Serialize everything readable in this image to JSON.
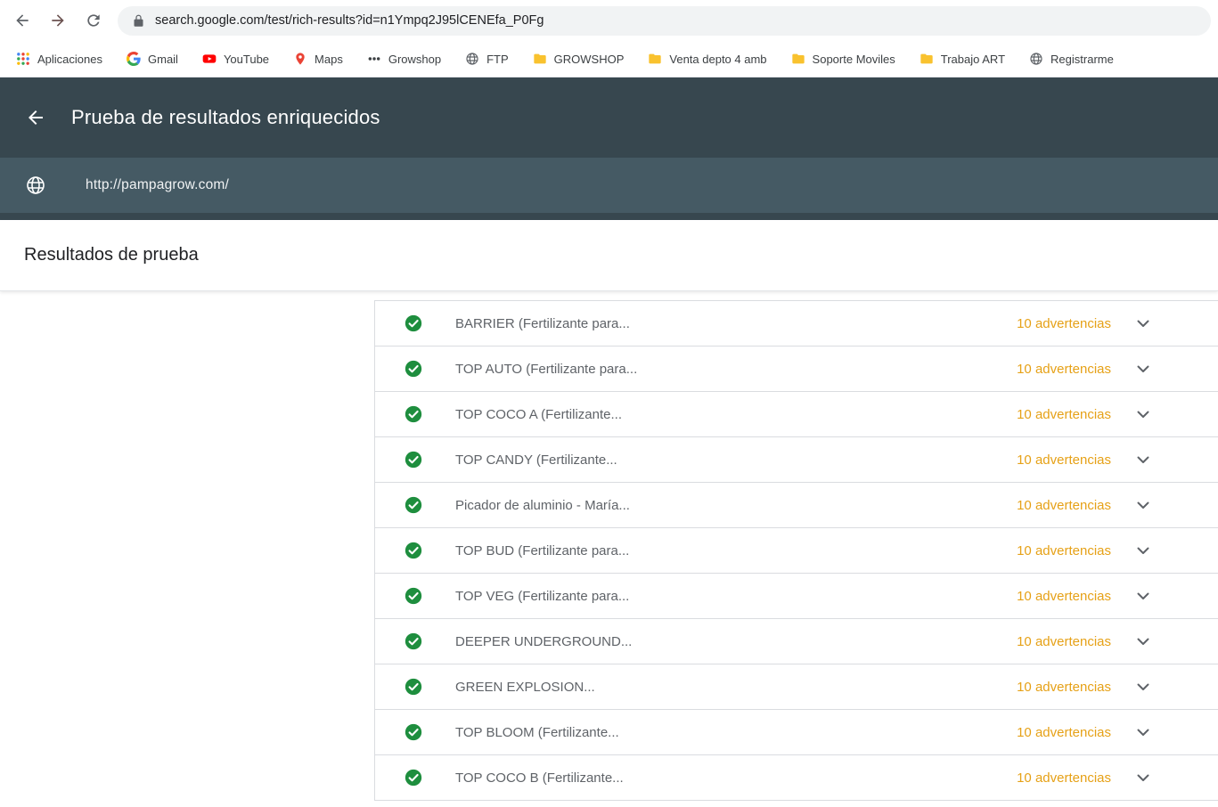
{
  "colors": {
    "app_header_bg": "#37474f",
    "tested_url_bg": "#455a64",
    "check_green": "#1e8e3e",
    "warning_amber": "#e6a117",
    "row_border": "#dadce0"
  },
  "browser": {
    "url": "search.google.com/test/rich-results?id=n1Ympq2J95lCENEfa_P0Fg",
    "bookmarks": [
      {
        "label": "Aplicaciones",
        "icon": "apps-grid-icon"
      },
      {
        "label": "Gmail",
        "icon": "google-g-icon"
      },
      {
        "label": "YouTube",
        "icon": "youtube-icon"
      },
      {
        "label": "Maps",
        "icon": "maps-pin-icon"
      },
      {
        "label": "Growshop",
        "icon": "dots-icon"
      },
      {
        "label": "FTP",
        "icon": "globe-icon"
      },
      {
        "label": "GROWSHOP",
        "icon": "folder-icon"
      },
      {
        "label": "Venta depto 4 amb",
        "icon": "folder-icon"
      },
      {
        "label": "Soporte Moviles",
        "icon": "folder-icon"
      },
      {
        "label": "Trabajo ART",
        "icon": "folder-icon"
      },
      {
        "label": "Registrarme",
        "icon": "globe-icon"
      }
    ]
  },
  "header": {
    "title": "Prueba de resultados enriquecidos",
    "tested_url": "http://pampagrow.com/"
  },
  "results": {
    "heading": "Resultados de prueba",
    "items": [
      {
        "name": "BARRIER (Fertilizante para...",
        "warnings": "10 advertencias"
      },
      {
        "name": "TOP AUTO (Fertilizante para...",
        "warnings": "10 advertencias"
      },
      {
        "name": "TOP COCO A (Fertilizante...",
        "warnings": "10 advertencias"
      },
      {
        "name": "TOP CANDY (Fertilizante...",
        "warnings": "10 advertencias"
      },
      {
        "name": "Picador de aluminio - María...",
        "warnings": "10 advertencias"
      },
      {
        "name": "TOP BUD (Fertilizante para...",
        "warnings": "10 advertencias"
      },
      {
        "name": "TOP VEG (Fertilizante para...",
        "warnings": "10 advertencias"
      },
      {
        "name": "DEEPER UNDERGROUND...",
        "warnings": "10 advertencias"
      },
      {
        "name": "GREEN EXPLOSION...",
        "warnings": "10 advertencias"
      },
      {
        "name": "TOP BLOOM (Fertilizante...",
        "warnings": "10 advertencias"
      },
      {
        "name": "TOP COCO B (Fertilizante...",
        "warnings": "10 advertencias"
      }
    ]
  }
}
